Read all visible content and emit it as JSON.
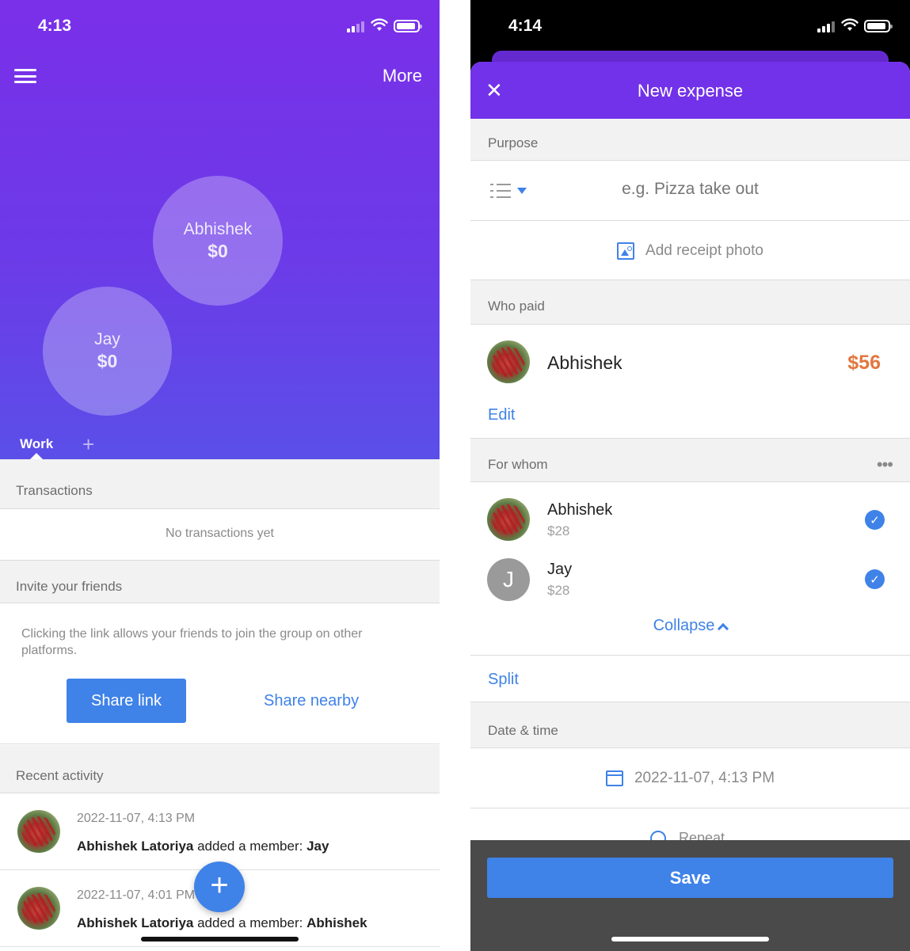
{
  "left": {
    "status": {
      "time": "4:13"
    },
    "header": {
      "more_label": "More"
    },
    "bubbles": [
      {
        "name": "Abhishek",
        "amount": "$0"
      },
      {
        "name": "Jay",
        "amount": "$0"
      }
    ],
    "group_tab": "Work",
    "add_group": "+",
    "transactions": {
      "heading": "Transactions",
      "empty_text": "No transactions yet"
    },
    "invite": {
      "heading": "Invite your friends",
      "description": "Clicking the link allows your friends to join the group on other platforms.",
      "share_link": "Share link",
      "share_nearby": "Share nearby"
    },
    "recent_activity": {
      "heading": "Recent activity",
      "items": [
        {
          "time": "2022-11-07, 4:13 PM",
          "actor": "Abhishek Latoriya",
          "action": " added a member: ",
          "target": "Jay"
        },
        {
          "time": "2022-11-07, 4:01 PM",
          "actor": "Abhishek Latoriya",
          "action": " added a member: ",
          "target": "Abhishek"
        }
      ]
    },
    "fab_label": "+"
  },
  "right": {
    "status": {
      "time": "4:14"
    },
    "header": {
      "title": "New expense",
      "close": "✕"
    },
    "purpose": {
      "heading": "Purpose",
      "placeholder": "e.g. Pizza take out"
    },
    "receipt": {
      "label": "Add receipt photo"
    },
    "who_paid": {
      "heading": "Who paid",
      "name": "Abhishek",
      "amount": "$56",
      "edit": "Edit"
    },
    "for_whom": {
      "heading": "For whom",
      "more": "•••",
      "people": [
        {
          "name": "Abhishek",
          "share": "$28",
          "initial": ""
        },
        {
          "name": "Jay",
          "share": "$28",
          "initial": "J"
        }
      ],
      "collapse": "Collapse"
    },
    "split": "Split",
    "date_time": {
      "heading": "Date & time",
      "value": "2022-11-07, 4:13 PM"
    },
    "repeat": "Repeat",
    "save": "Save"
  },
  "colors": {
    "purple": "#7232e9",
    "accent_blue": "#3f82e8",
    "amount_orange": "#e2773f"
  }
}
